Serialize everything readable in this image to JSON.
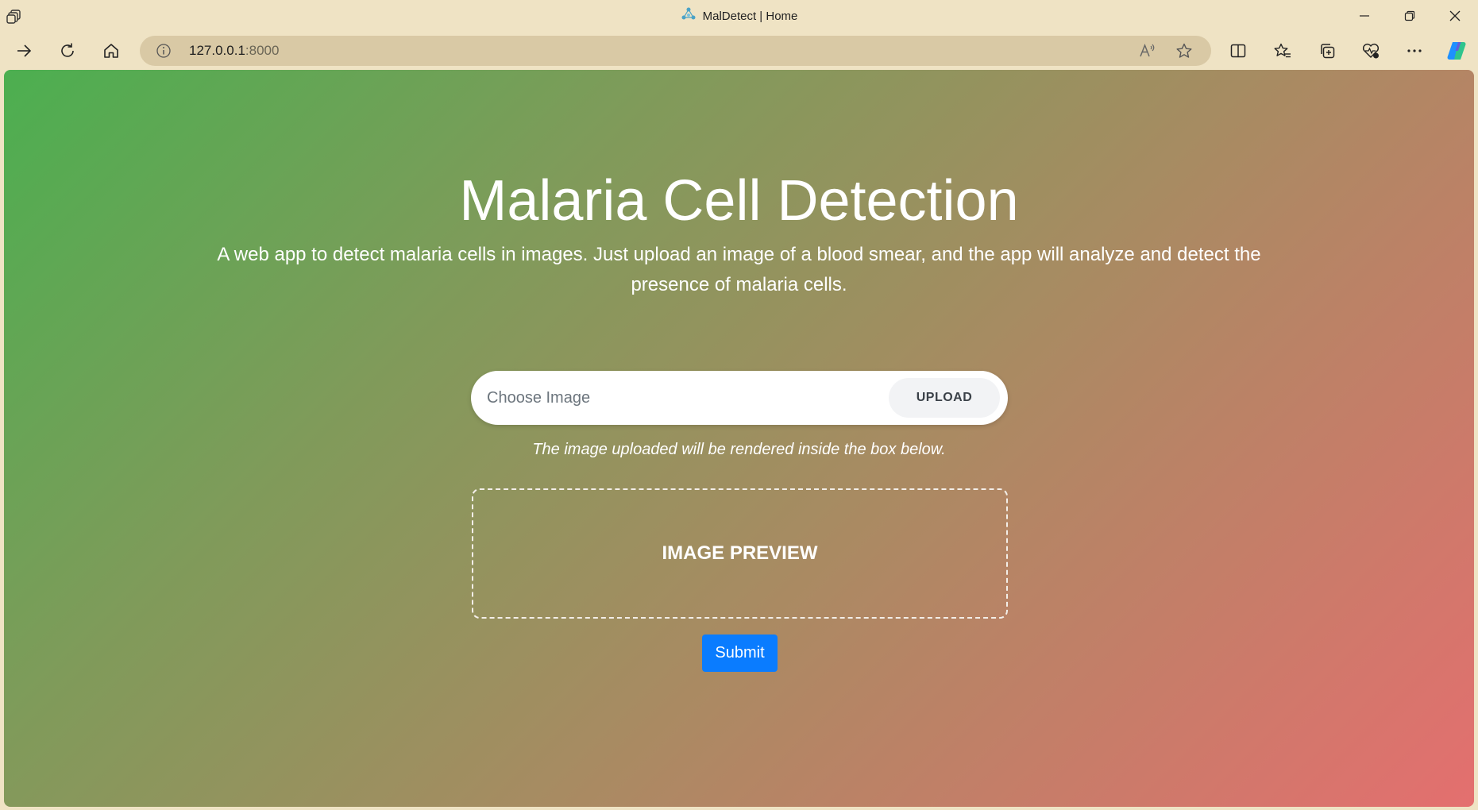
{
  "window": {
    "title": "MalDetect | Home"
  },
  "toolbar": {
    "url_host": "127.0.0.1",
    "url_port": ":8000"
  },
  "page": {
    "heading": "Malaria Cell Detection",
    "description": "A web app to detect malaria cells in images. Just upload an image of a blood smear, and the app will analyze and detect the presence of malaria cells.",
    "upload": {
      "placeholder": "Choose Image",
      "button_label": "UPLOAD"
    },
    "hint": "The image uploaded will be rendered inside the box below.",
    "preview_label": "IMAGE PREVIEW",
    "submit_label": "Submit"
  },
  "colors": {
    "gradient_start": "#4caf50",
    "gradient_end": "#e46f6f",
    "submit_button": "#0a7cff",
    "browser_chrome": "#efe3c4"
  },
  "icons": {
    "titlebar": [
      "tab-actions-icon",
      "app-logo-icon",
      "minimize-icon",
      "restore-icon",
      "close-icon"
    ],
    "toolbar": [
      "forward-icon",
      "refresh-icon",
      "home-icon",
      "info-icon",
      "read-aloud-icon",
      "favorite-star-icon",
      "split-screen-icon",
      "favorites-icon",
      "collections-icon",
      "browser-essentials-icon",
      "more-icon",
      "copilot-icon"
    ]
  }
}
